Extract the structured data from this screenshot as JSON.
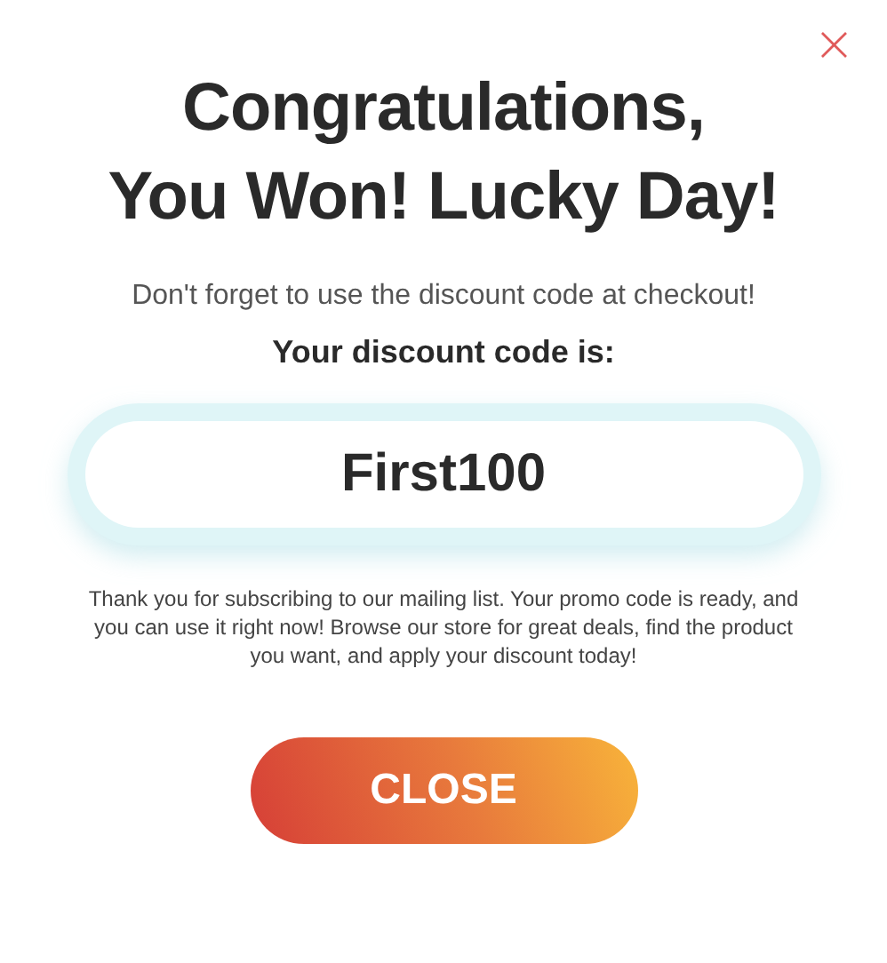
{
  "close_icon": "×",
  "title_lines": [
    "Congratulations,",
    "You Won! Lucky Day!"
  ],
  "subtitle": "Don't forget to use the discount code at checkout!",
  "code_label": "Your discount code is:",
  "code": "First100",
  "message": "Thank you for subscribing to our mailing list. Your promo code is ready, and you can use it right now! Browse our store for great deals, find the product you want, and apply your discount today!",
  "button": "CLOSE"
}
